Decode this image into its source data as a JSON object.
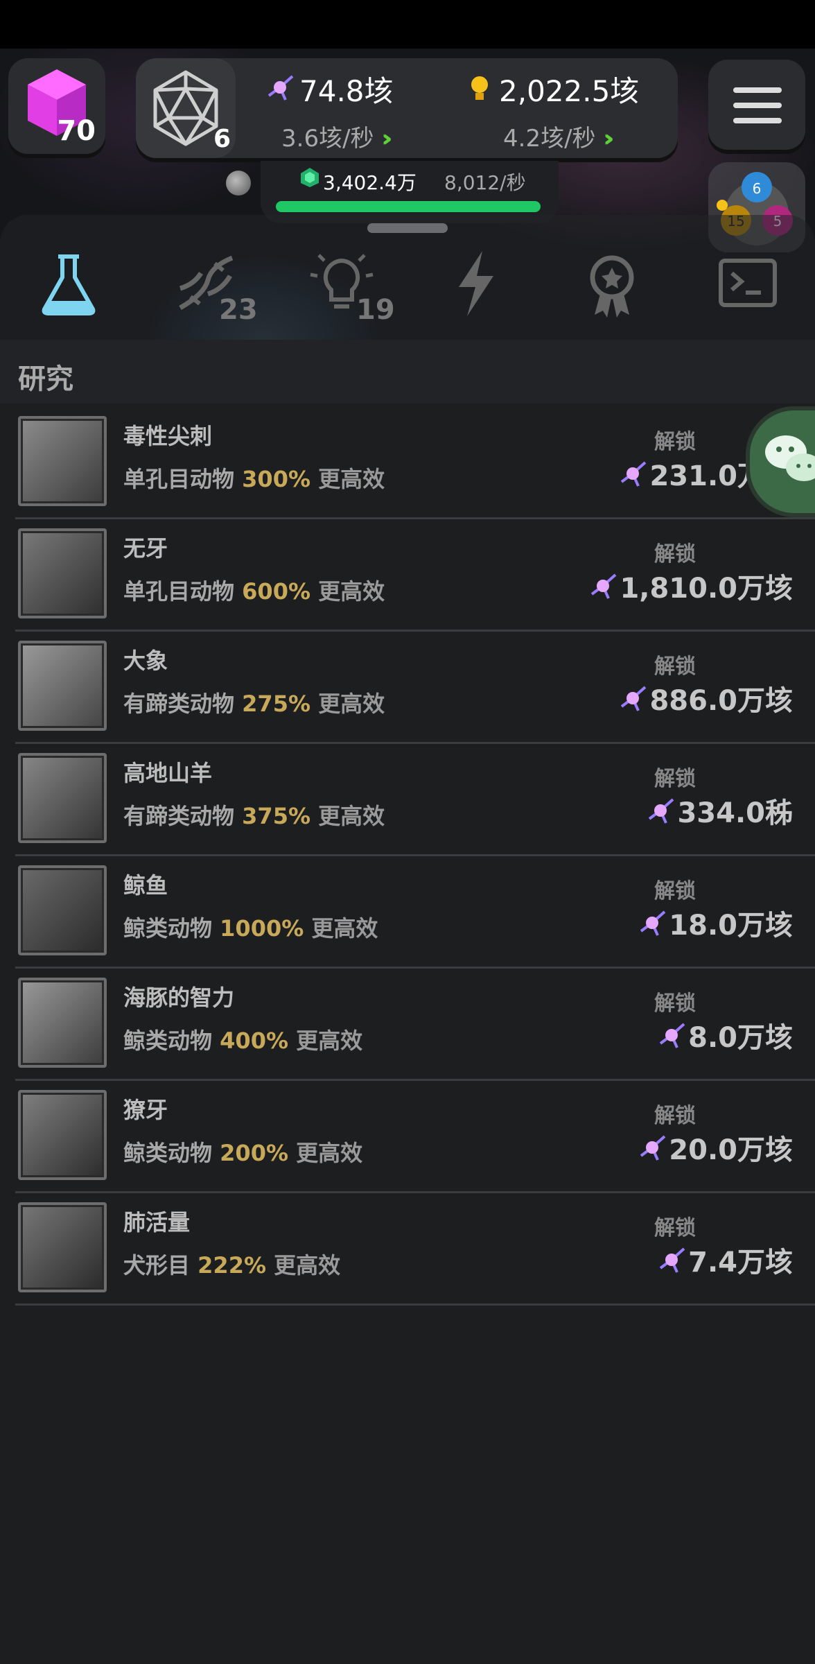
{
  "hud": {
    "cube_count": "70",
    "d20_count": "6",
    "dark_matter_total": "74.8垓",
    "dark_matter_rate": "3.6垓/秒",
    "ideas_total": "2,022.5垓",
    "ideas_rate": "4.2垓/秒",
    "gems_total": "3,402.4万",
    "gems_rate": "8,012/秒",
    "gems_progress_pct": 100,
    "pie_badges": [
      "6",
      "15",
      "5"
    ]
  },
  "tabs": [
    {
      "name": "research",
      "icon": "flask-icon",
      "badge": ""
    },
    {
      "name": "dna",
      "icon": "dna-icon",
      "badge": "23"
    },
    {
      "name": "ideas",
      "icon": "lightbulb-icon",
      "badge": "19"
    },
    {
      "name": "boost",
      "icon": "lightning-icon",
      "badge": ""
    },
    {
      "name": "achievements",
      "icon": "medal-icon",
      "badge": ""
    },
    {
      "name": "console",
      "icon": "terminal-icon",
      "badge": ""
    }
  ],
  "section": {
    "title": "研究"
  },
  "research_items": [
    {
      "name": "毒性尖刺",
      "category": "单孔目动物",
      "percent": "300%",
      "suffix": "更高效",
      "unlock": "解锁",
      "cost": "231.0万垓"
    },
    {
      "name": "无牙",
      "category": "单孔目动物",
      "percent": "600%",
      "suffix": "更高效",
      "unlock": "解锁",
      "cost": "1,810.0万垓"
    },
    {
      "name": "大象",
      "category": "有蹄类动物",
      "percent": "275%",
      "suffix": "更高效",
      "unlock": "解锁",
      "cost": "886.0万垓"
    },
    {
      "name": "高地山羊",
      "category": "有蹄类动物",
      "percent": "375%",
      "suffix": "更高效",
      "unlock": "解锁",
      "cost": "334.0秭"
    },
    {
      "name": "鲸鱼",
      "category": "鲸类动物",
      "percent": "1000%",
      "suffix": "更高效",
      "unlock": "解锁",
      "cost": "18.0万垓"
    },
    {
      "name": "海豚的智力",
      "category": "鲸类动物",
      "percent": "400%",
      "suffix": "更高效",
      "unlock": "解锁",
      "cost": "8.0万垓"
    },
    {
      "name": "獠牙",
      "category": "鲸类动物",
      "percent": "200%",
      "suffix": "更高效",
      "unlock": "解锁",
      "cost": "20.0万垓"
    },
    {
      "name": "肺活量",
      "category": "犬形目",
      "percent": "222%",
      "suffix": "更高效",
      "unlock": "解锁",
      "cost": "7.4万垓"
    }
  ]
}
